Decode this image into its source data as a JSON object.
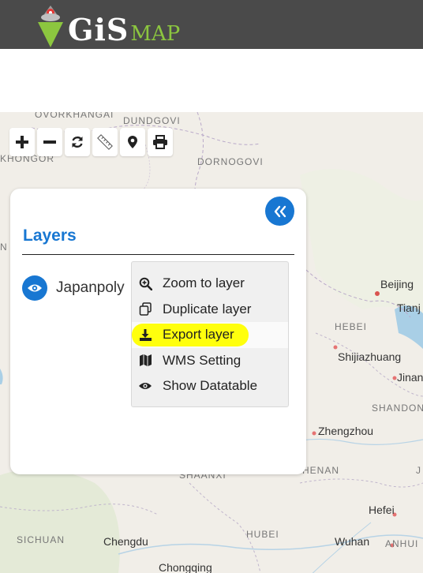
{
  "header": {
    "logo_gis": "GiS",
    "logo_map": "MAP",
    "bg_color": "#4a4a4a",
    "accent_color": "#8cc63f"
  },
  "map": {
    "places": {
      "ovorkhangai": "OVORKHANGAI",
      "dundgovi": "DUNDGOVI",
      "khongor": "KHONGOR",
      "dornogovi": "DORNOGOVI",
      "beijing": "Beijing",
      "tianjin": "Tianj",
      "hebei": "HEBEI",
      "shijiazhuang": "Shijiazhuang",
      "jinan": "Jinan",
      "shandong": "SHANDON",
      "zhengzhou": "Zhengzhou",
      "henan": "HENAN",
      "shaanxi": "SHAANXI",
      "hefei": "Hefei",
      "sichuan": "SICHUAN",
      "chengdu": "Chengdu",
      "hubei": "HUBEI",
      "wuhan": "Wuhan",
      "anhui": "ANHUI",
      "chongqing": "Chongqing",
      "edge_n": "N",
      "edge_j": "J"
    }
  },
  "toolbar": {
    "items": [
      {
        "name": "zoom-in",
        "icon": "plus-icon"
      },
      {
        "name": "zoom-out",
        "icon": "minus-icon"
      },
      {
        "name": "refresh",
        "icon": "refresh-icon"
      },
      {
        "name": "measure",
        "icon": "ruler-icon"
      },
      {
        "name": "locate",
        "icon": "map-marker-icon"
      },
      {
        "name": "print",
        "icon": "print-icon"
      }
    ]
  },
  "layers_panel": {
    "title": "Layers",
    "accent_color": "#1877d2",
    "layers": [
      {
        "name": "Japanpoly",
        "visible": true
      }
    ]
  },
  "context_menu": {
    "items": [
      {
        "label": "Zoom to layer",
        "icon": "zoom-in-icon"
      },
      {
        "label": "Duplicate layer",
        "icon": "copy-icon"
      },
      {
        "label": "Export layer",
        "icon": "download-icon",
        "highlighted": true
      },
      {
        "label": "WMS Setting",
        "icon": "map-icon"
      },
      {
        "label": "Show Datatable",
        "icon": "eye-icon"
      }
    ]
  }
}
